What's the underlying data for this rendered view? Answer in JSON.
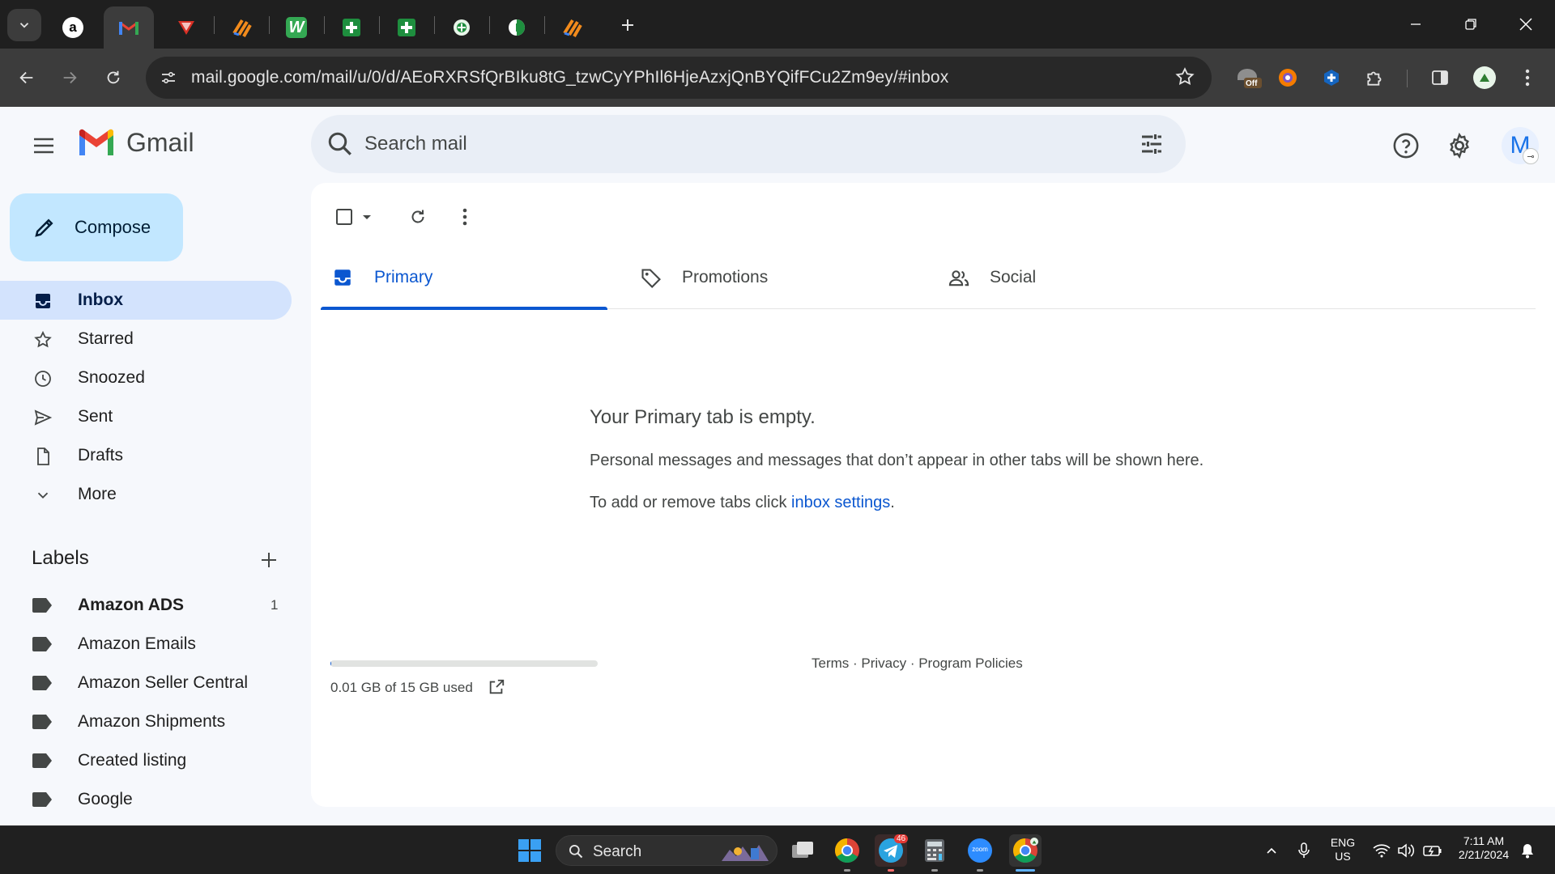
{
  "browser": {
    "tabs": [
      {
        "name": "amazon-tab",
        "glyph": "a",
        "color": "#000000"
      },
      {
        "name": "gmail-tab",
        "glyph": "M",
        "color": "#ea4335"
      },
      {
        "name": "tab-3",
        "glyph": "▼",
        "color": "#b3261e"
      },
      {
        "name": "tab-4",
        "glyph": "▚",
        "color": "#f28b1c"
      },
      {
        "name": "tab-5",
        "glyph": "W",
        "color": "#34a853"
      },
      {
        "name": "sheets-tab-1",
        "glyph": "+",
        "color": "#1e8e3e"
      },
      {
        "name": "sheets-tab-2",
        "glyph": "+",
        "color": "#1e8e3e"
      },
      {
        "name": "tab-8",
        "glyph": "◐",
        "color": "#34a853"
      },
      {
        "name": "tab-9",
        "glyph": "◑",
        "color": "#34a853"
      },
      {
        "name": "tab-10",
        "glyph": "▚",
        "color": "#f28b1c"
      }
    ],
    "url": "mail.google.com/mail/u/0/d/AEoRXRSfQrBIku8tG_tzwCyYPhIl6HjeAzxjQnBYQifFCu2Zm9ey/#inbox",
    "ext_badge_off": "Off"
  },
  "gmail": {
    "logo_text": "Gmail",
    "search_placeholder": "Search mail",
    "avatar_letter": "M",
    "compose_label": "Compose",
    "nav": [
      {
        "label": "Inbox",
        "icon": "inbox-icon",
        "active": true
      },
      {
        "label": "Starred",
        "icon": "star-icon"
      },
      {
        "label": "Snoozed",
        "icon": "clock-icon"
      },
      {
        "label": "Sent",
        "icon": "send-icon"
      },
      {
        "label": "Drafts",
        "icon": "draft-icon"
      },
      {
        "label": "More",
        "icon": "chevron-down-icon"
      }
    ],
    "labels_title": "Labels",
    "labels": [
      {
        "label": "Amazon ADS",
        "count": "1",
        "bold": true
      },
      {
        "label": "Amazon Emails"
      },
      {
        "label": "Amazon Seller Central"
      },
      {
        "label": "Amazon Shipments"
      },
      {
        "label": "Created listing"
      },
      {
        "label": "Google"
      }
    ],
    "category_tabs": [
      {
        "label": "Primary",
        "icon": "inbox-icon",
        "active": true
      },
      {
        "label": "Promotions",
        "icon": "tag-icon"
      },
      {
        "label": "Social",
        "icon": "people-icon"
      }
    ],
    "empty": {
      "title": "Your Primary tab is empty.",
      "line1": "Personal messages and messages that don’t appear in other tabs will be shown here.",
      "line2_prefix": "To add or remove tabs click ",
      "line2_link": "inbox settings",
      "line2_suffix": "."
    },
    "storage": {
      "text": "0.01 GB of 15 GB used",
      "used_fraction": 0.001
    },
    "footer": "Terms · Privacy · Program Policies"
  },
  "taskbar": {
    "search_label": "Search",
    "telegram_badge": "46",
    "zoom_label": "zoom",
    "lang_line1": "ENG",
    "lang_line2": "US",
    "time": "7:11 AM",
    "date": "2/21/2024"
  },
  "colors": {
    "accent": "#0b57d0",
    "compose_bg": "#c2e7ff",
    "active_nav": "#d3e3fd"
  }
}
